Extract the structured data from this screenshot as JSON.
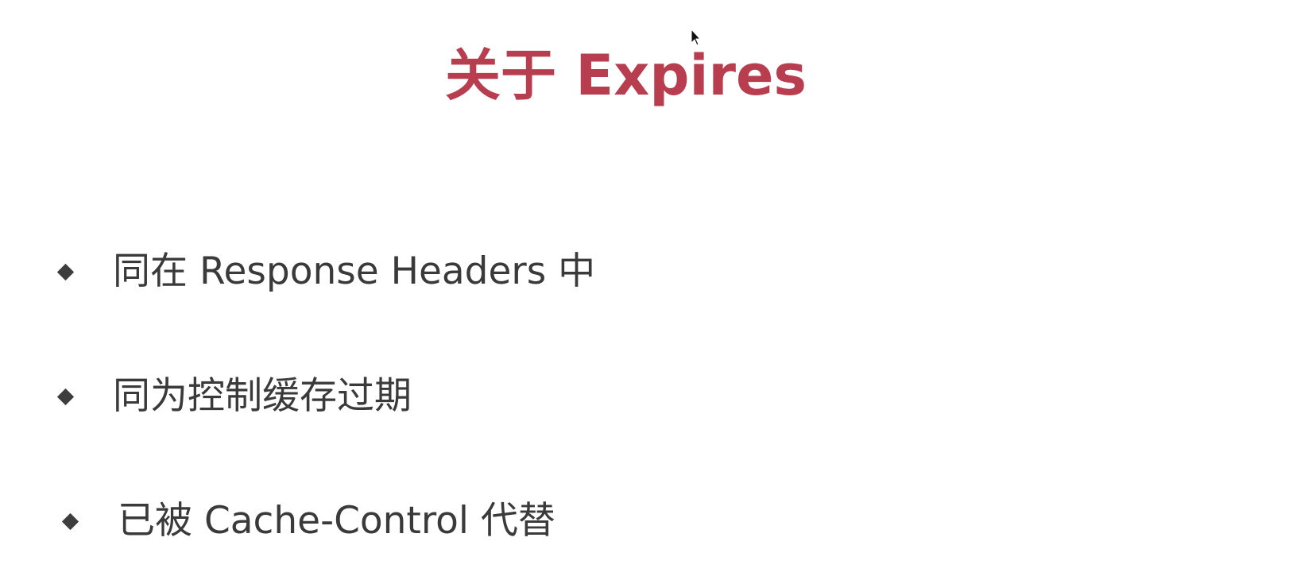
{
  "slide": {
    "title": "关于 Expires",
    "title_color": "#b83e4f",
    "bullets": [
      {
        "text": "同在 Response Headers 中"
      },
      {
        "text": "同为控制缓存过期"
      },
      {
        "text": "已被 Cache-Control 代替"
      }
    ],
    "bullet_marker_icon": "diamond-bullet-icon",
    "text_color": "#3a3a3a",
    "background_color": "#ffffff"
  },
  "cursor": {
    "icon": "mouse-pointer-icon"
  }
}
